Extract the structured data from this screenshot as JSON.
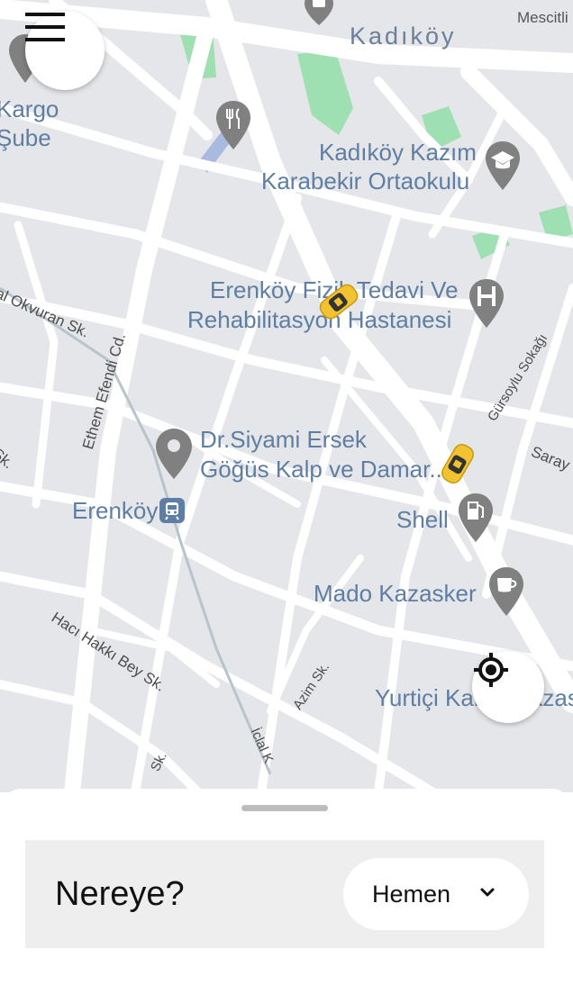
{
  "map": {
    "area_labels": {
      "kadikoy": "Kadıköy",
      "mescitli": "Mescitli"
    },
    "poi_labels": {
      "kargo_line1": "Kargo",
      "kargo_line2": "Şube",
      "school_line1": "Kadıköy Kazım",
      "school_line2": "Karabekir Ortaokulu",
      "hospital_line1": "Erenköy Fizik Tedavi Ve",
      "hospital_line2": "Rehabilitasyon Hastanesi",
      "clinic_line1": "Dr.Siyami Ersek",
      "clinic_line2": "Göğüs Kalp ve Damar...",
      "station": "Erenköy",
      "fuel": "Shell",
      "cafe": "Mado Kazasker",
      "courier": "Yurtiçi Kargo Kazas"
    },
    "street_labels": {
      "okvuran": "al Okvuran Sk.",
      "ethem": "Ethem Efendi Cd.",
      "gursoylu": "Gürsoylu Sokağı",
      "saray": "Saray",
      "sk_left": "Sk.",
      "haci_hakki": "Hacı Hakkı Bey Sk.",
      "azim": "Azim Sk.",
      "iclal": "İclal K",
      "sk_bottom": "Sk."
    }
  },
  "sheet": {
    "prompt": "Nereye?",
    "time_option": "Hemen"
  },
  "icons": {
    "menu": "hamburger-menu-icon",
    "locate": "my-location-icon",
    "dropdown": "chevron-down-icon"
  },
  "colors": {
    "map_background": "#e5e6e9",
    "road": "#ffffff",
    "park": "#8fd8a8",
    "label_blue": "#5f7ea3",
    "pin_gray": "#808080",
    "taxi_yellow": "#f2c230",
    "search_bar": "#eeeeee"
  }
}
